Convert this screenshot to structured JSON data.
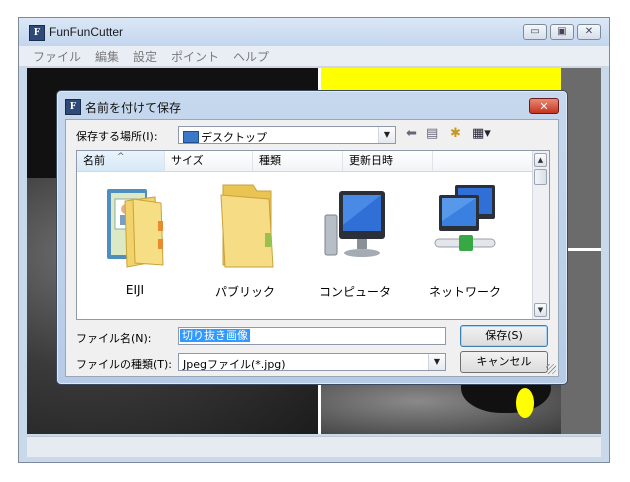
{
  "app": {
    "title": "FunFunCutter",
    "icon_letter": "F",
    "menu": [
      "ファイル",
      "編集",
      "設定",
      "ポイント",
      "ヘルプ"
    ],
    "caption_buttons": [
      "minimize-icon",
      "maximize-icon",
      "close-icon"
    ]
  },
  "dialog": {
    "title": "名前を付けて保存",
    "icon_letter": "F",
    "close_glyph": "✕",
    "save_in_label": "保存する場所(I):",
    "save_in_value": "デスクトップ",
    "toolbar_icons": [
      "back-arrow-icon",
      "up-folder-icon",
      "new-folder-icon",
      "view-menu-icon"
    ],
    "columns": [
      "名前",
      "サイズ",
      "種類",
      "更新日時"
    ],
    "sorted_column": "名前",
    "items": [
      {
        "label": "EIJI",
        "icon": "user-folder-icon"
      },
      {
        "label": "パブリック",
        "icon": "folder-icon"
      },
      {
        "label": "コンピュータ",
        "icon": "computer-icon"
      },
      {
        "label": "ネットワーク",
        "icon": "network-icon"
      }
    ],
    "filename_label": "ファイル名(N):",
    "filename_value": "切り抜き画像",
    "filetype_label": "ファイルの種類(T):",
    "filetype_value": "Jpegファイル(*.jpg)",
    "save_button": "保存(S)",
    "cancel_button": "キャンセル"
  },
  "colors": {
    "highlight_yellow": "#ffff00",
    "selection_blue": "#3399ff",
    "close_red": "#c5341d"
  }
}
